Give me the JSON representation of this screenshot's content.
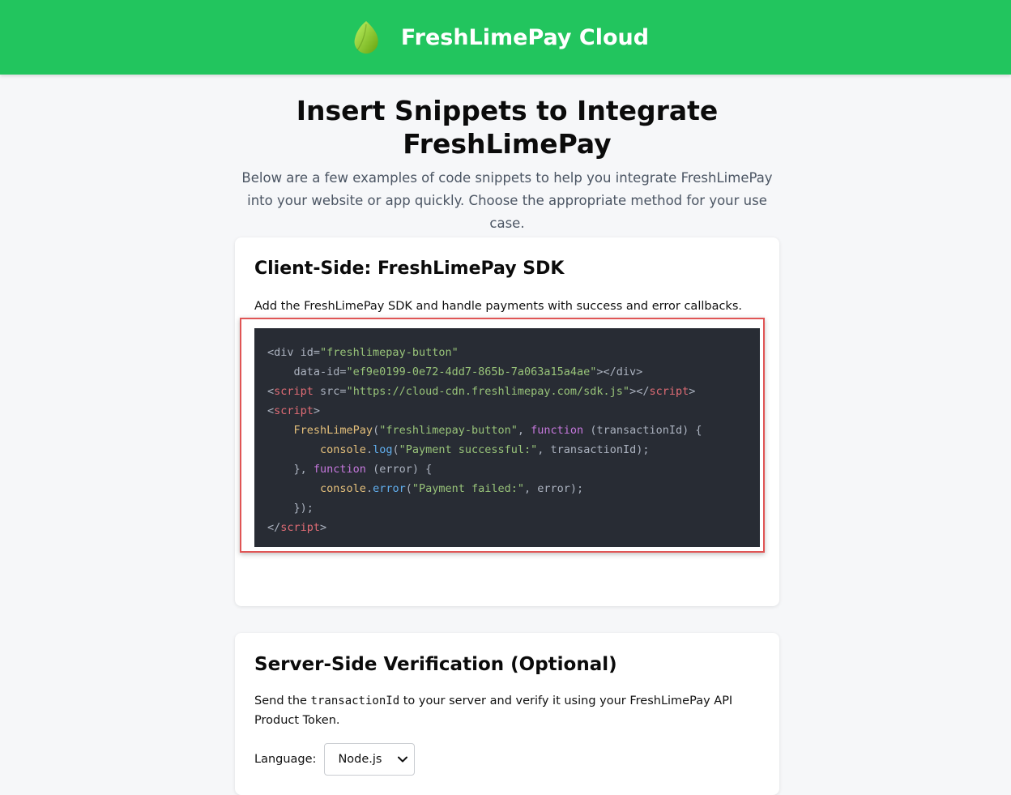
{
  "header": {
    "brand_name": "FreshLimePay Cloud",
    "logo_icon": "leaf-icon",
    "background_color": "#22c55e"
  },
  "page": {
    "title": "Insert Snippets to Integrate FreshLimePay",
    "intro": "Below are a few examples of code snippets to help you integrate FreshLimePay into your website or app quickly. Choose the appropriate method for your use case."
  },
  "client_card": {
    "title": "Client-Side: FreshLimePay SDK",
    "description": "Add the FreshLimePay SDK and handle payments with success and error callbacks.",
    "code": {
      "l1_open": "<div id=",
      "l1_val": "\"freshlimepay-button\"",
      "l2_indent": "    data-id=",
      "l2_val": "\"ef9e0199-0e72-4dd7-865b-7a063a15a4ae\"",
      "l2_close": "></div>",
      "l3_open": "<",
      "l3_tag": "script",
      "l3_src": " src=",
      "l3_val": "\"https://cloud-cdn.freshlimepay.com/sdk.js\"",
      "l3_mid": "></",
      "l3_close": ">",
      "l4_open": "<",
      "l4_tag": "script",
      "l4_close": ">",
      "l5_indent": "    ",
      "l5_fn": "FreshLimePay",
      "l5_paren": "(",
      "l5_str": "\"freshlimepay-button\"",
      "l5_comma": ", ",
      "l5_kw": "function",
      "l5_rest": " (transactionId) {",
      "l6_indent": "        ",
      "l6_obj": "console",
      "l6_dot": ".",
      "l6_method": "log",
      "l6_paren": "(",
      "l6_str": "\"Payment successful:\"",
      "l6_rest": ", transactionId);",
      "l7_indent": "    }, ",
      "l7_kw": "function",
      "l7_rest": " (error) {",
      "l8_indent": "        ",
      "l8_obj": "console",
      "l8_dot": ".",
      "l8_method": "error",
      "l8_paren": "(",
      "l8_str": "\"Payment failed:\"",
      "l8_rest": ", error);",
      "l9": "    });",
      "l10_open": "</",
      "l10_tag": "script",
      "l10_close": ">"
    }
  },
  "server_card": {
    "title": "Server-Side Verification (Optional)",
    "description_pre": "Send the ",
    "description_code": "transactionId",
    "description_post": " to your server and verify it using your FreshLimePay API Product Token.",
    "language_label": "Language:",
    "language_selected": "Node.js"
  }
}
